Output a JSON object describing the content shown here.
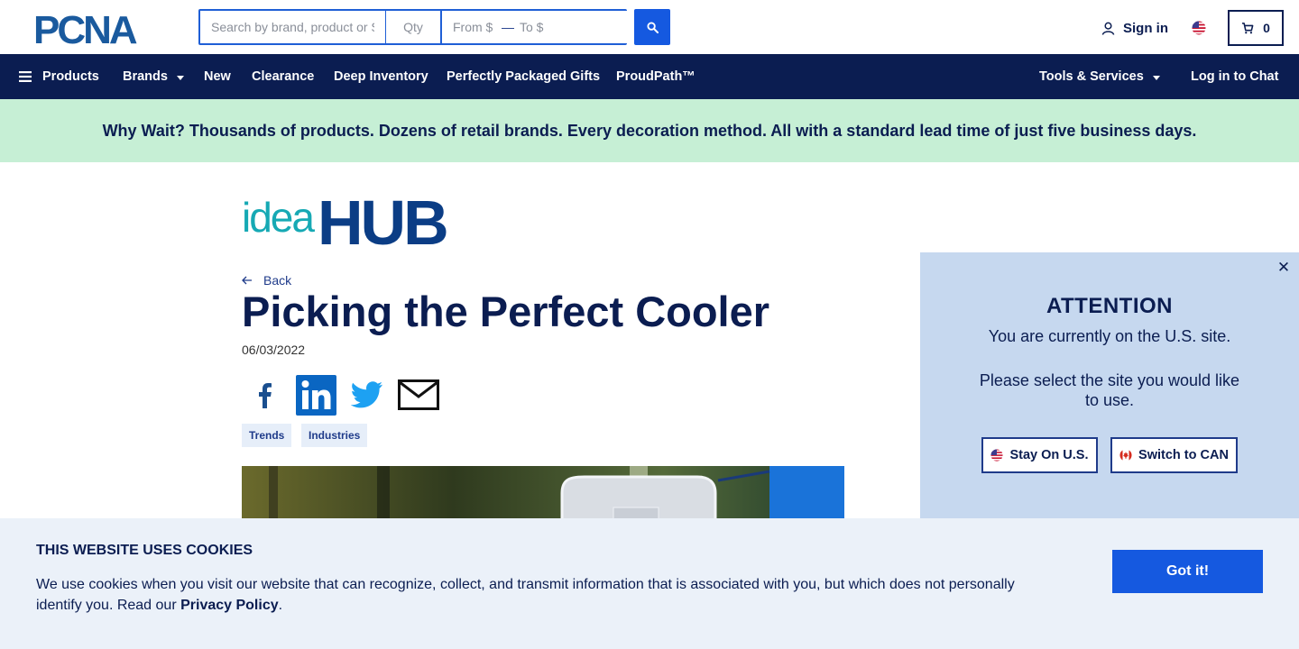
{
  "header": {
    "logo_text": "PCNA",
    "search": {
      "placeholder": "Search by brand, product or SKU",
      "qty_placeholder": "Qty",
      "from_placeholder": "From $",
      "to_placeholder": "To $",
      "dash": "—"
    },
    "signin_label": "Sign in",
    "cart_count": "0",
    "icons": {
      "search": "search-icon",
      "user": "user-icon",
      "flag": "us-flag-icon",
      "cart": "cart-icon"
    }
  },
  "nav": {
    "products": "Products",
    "brands": "Brands",
    "new": "New",
    "clearance": "Clearance",
    "deep_inventory": "Deep Inventory",
    "perfectly_packaged_gifts": "Perfectly Packaged Gifts",
    "proudpath": "ProudPath™",
    "tools_services": "Tools & Services",
    "login_chat": "Log in to Chat"
  },
  "banner": {
    "text": "Why Wait? Thousands of products. Dozens of retail brands. Every decoration method. All with a standard lead time of just five business days."
  },
  "article": {
    "brand_logo": {
      "idea": "idea",
      "hub": "HUB"
    },
    "back_label": "Back",
    "title": "Picking the Perfect Cooler",
    "date": "06/03/2022",
    "share_icons": [
      "facebook-icon",
      "linkedin-icon",
      "twitter-icon",
      "email-icon"
    ],
    "tags": [
      "Trends",
      "Industries"
    ]
  },
  "attention": {
    "title": "ATTENTION",
    "line1": "You are currently on the U.S. site.",
    "line2": "Please select the site you would like to use.",
    "stay_label": "Stay On U.S.",
    "switch_label": "Switch to CAN",
    "close_glyph": "✕"
  },
  "cookies": {
    "title": "THIS WEBSITE USES COOKIES",
    "text_before": "We use cookies when you visit our website that can recognize, collect, and transmit information that is associated with you, but which does not personally identify you. Read our ",
    "privacy_link": "Privacy Policy",
    "text_after": ".",
    "button_label": "Got it!"
  },
  "colors": {
    "navy": "#0b1d51",
    "accent_blue": "#1559e0",
    "banner_green": "#c6efd5",
    "attention_bg": "#c6d8ef",
    "cookies_bg": "#ebf1f9",
    "teal": "#16a9b4"
  }
}
